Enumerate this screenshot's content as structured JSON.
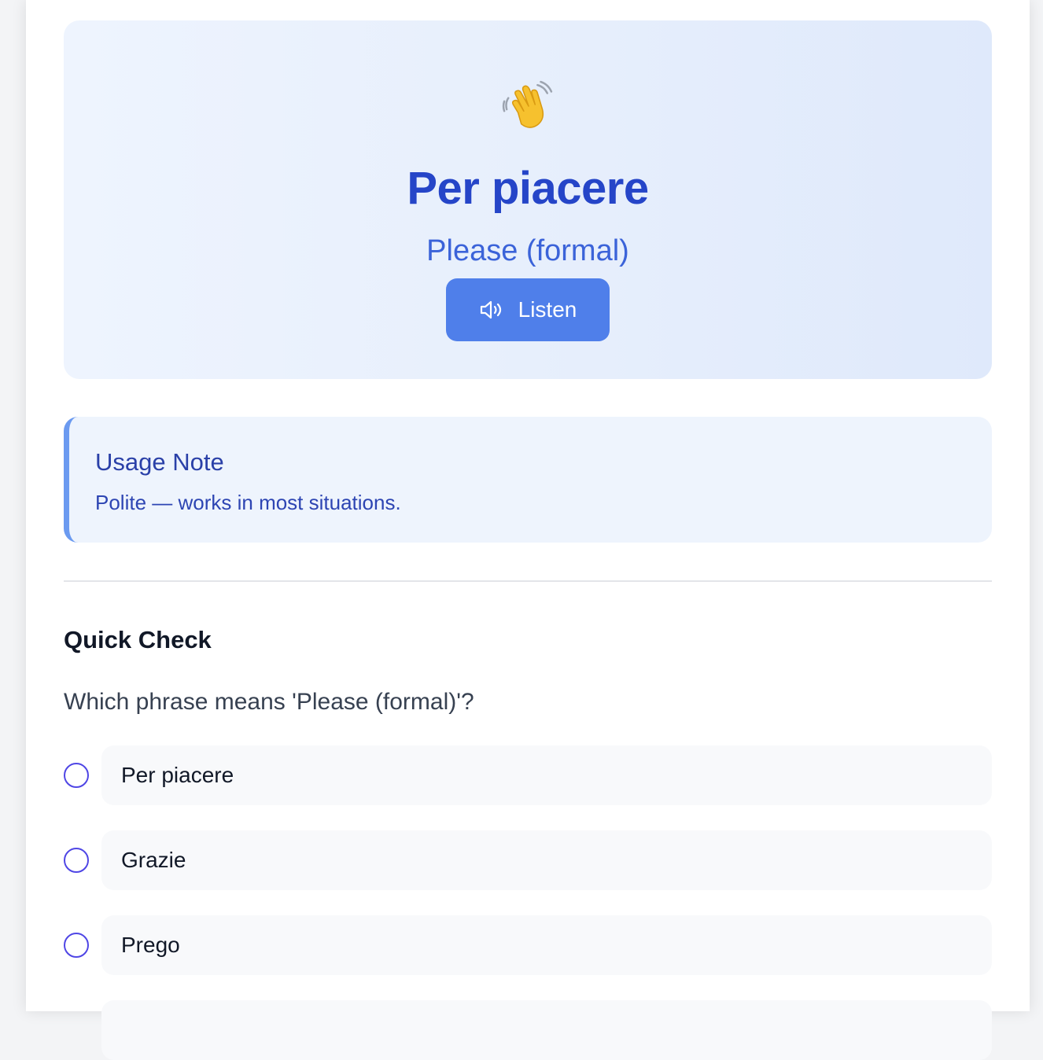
{
  "hero": {
    "icon": "waving-hand-icon",
    "phrase": "Per piacere",
    "translation": "Please (formal)",
    "listen_label": "Listen",
    "listen_icon": "speaker-icon"
  },
  "usage_note": {
    "title": "Usage Note",
    "body": "Polite — works in most situations."
  },
  "quiz": {
    "title": "Quick Check",
    "question": "Which phrase means 'Please (formal)'?",
    "options": [
      {
        "label": "Per piacere"
      },
      {
        "label": "Grazie"
      },
      {
        "label": "Prego"
      }
    ]
  },
  "colors": {
    "accent": "#4f7fea",
    "phrase": "#2545c8",
    "radio": "#4f46e5"
  }
}
